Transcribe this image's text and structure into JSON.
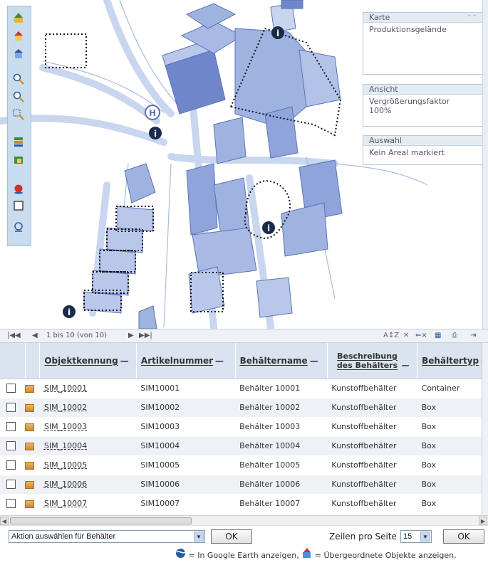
{
  "map_toolbar": {
    "tools": [
      {
        "icon": "go-up-icon"
      },
      {
        "icon": "home-icon"
      },
      {
        "icon": "building-icon"
      },
      {
        "icon": "zoom-in-icon"
      },
      {
        "icon": "zoom-out-icon"
      },
      {
        "icon": "zoom-area-icon"
      },
      {
        "icon": "layers-icon"
      },
      {
        "icon": "map-layer-icon"
      },
      {
        "icon": "record-icon"
      },
      {
        "icon": "select-rectangle-icon"
      },
      {
        "icon": "search-icon"
      }
    ]
  },
  "panels": {
    "karte": {
      "title": "Karte",
      "value": "Produktionsgelände"
    },
    "ansicht": {
      "title": "Ansicht",
      "value": "Vergrößerungsfaktor 100%"
    },
    "auswahl": {
      "title": "Auswahl",
      "value": "Kein Areal markiert"
    }
  },
  "pager": {
    "range_text": "1 bis 10 (von 10)"
  },
  "table": {
    "columns": [
      "Objektkennung",
      "Artikelnummer",
      "Behältername",
      "Beschreibung des Behälters",
      "Behältertyp"
    ],
    "rows": [
      [
        "SIM_10001",
        "SIM10001",
        "Behälter 10001",
        "Kunstoffbehälter",
        "Container"
      ],
      [
        "SIM_10002",
        "SIM10002",
        "Behälter 10002",
        "Kunstoffbehälter",
        "Box"
      ],
      [
        "SIM_10003",
        "SIM10003",
        "Behälter 10003",
        "Kunstoffbehälter",
        "Box"
      ],
      [
        "SIM_10004",
        "SIM10004",
        "Behälter 10004",
        "Kunstoffbehälter",
        "Box"
      ],
      [
        "SIM_10005",
        "SIM10005",
        "Behälter 10005",
        "Kunstoffbehälter",
        "Box"
      ],
      [
        "SIM_10006",
        "SIM10006",
        "Behälter 10006",
        "Kunstoffbehälter",
        "Box"
      ],
      [
        "SIM_10007",
        "SIM10007",
        "Behälter 10007",
        "Kunstoffbehälter",
        "Box"
      ]
    ]
  },
  "actions": {
    "action_select": "Aktion auswählen für Behälter",
    "ok_label": "OK",
    "rows_label": "Zeilen pro Seite",
    "rows_value": "15"
  },
  "legend": {
    "earth": "= In Google Earth anzeigen,",
    "parent": "= Übergeordnete Objekte anzeigen,"
  },
  "colors": {
    "building": "#9fb3e0",
    "building_dark": "#6f87c9",
    "path": "#c8d6ef",
    "toolbar": "#c9dcee"
  }
}
